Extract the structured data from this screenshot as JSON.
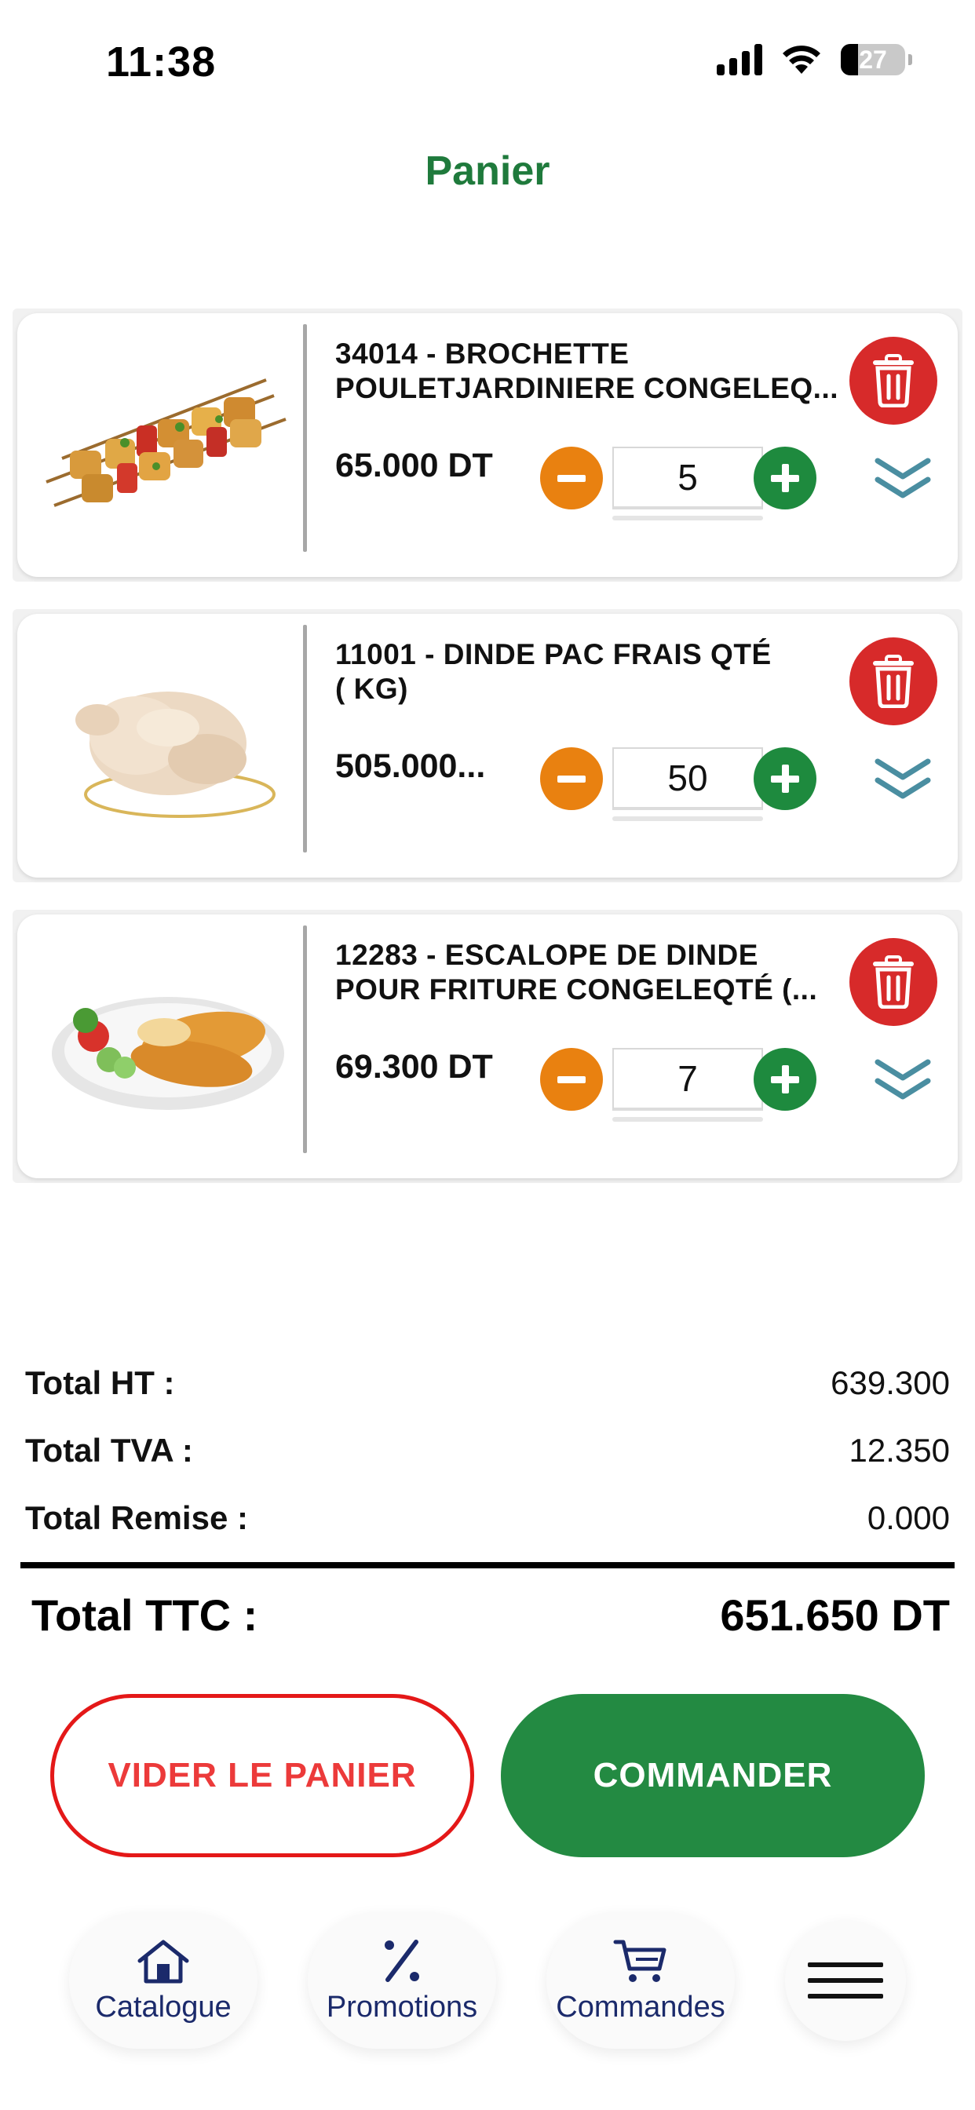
{
  "status_bar": {
    "time": "11:38",
    "battery_percent": "27",
    "battery_level": 0.27,
    "icons": [
      "signal-icon",
      "wifi-icon",
      "battery-icon"
    ]
  },
  "header": {
    "title": "Panier"
  },
  "cart": {
    "items": [
      {
        "name": "34014 - BROCHETTE\nPOULETJARDINIERE CONGELEQ...",
        "price": "65.000 DT",
        "quantity": "5",
        "image": "chicken-skewers-image"
      },
      {
        "name": "11001 - DINDE PAC FRAIS QTÉ\n( KG)",
        "price": "505.000...",
        "quantity": "50",
        "image": "raw-turkey-image"
      },
      {
        "name": "12283 - ESCALOPE DE DINDE\nPOUR FRITURE CONGELEQTÉ (...",
        "price": "69.300 DT",
        "quantity": "7",
        "image": "breaded-escalope-image"
      }
    ]
  },
  "totals": {
    "ht_label": "Total HT :",
    "ht_value": "639.300",
    "tva_label": "Total TVA :",
    "tva_value": "12.350",
    "remise_label": "Total Remise :",
    "remise_value": "0.000",
    "ttc_label": "Total TTC :",
    "ttc_value": "651.650 DT"
  },
  "actions": {
    "clear_label": "VIDER LE PANIER",
    "order_label": "COMMANDER"
  },
  "bottom_nav": {
    "catalogue": "Catalogue",
    "promotions": "Promotions",
    "commandes": "Commandes"
  },
  "colors": {
    "brand_green": "#1f7a3c",
    "order_green": "#238a42",
    "minus_orange": "#e98110",
    "plus_green": "#1e8a3e",
    "delete_red": "#d72a2a",
    "clear_red": "#e41818",
    "nav_blue": "#1b2a6b"
  }
}
